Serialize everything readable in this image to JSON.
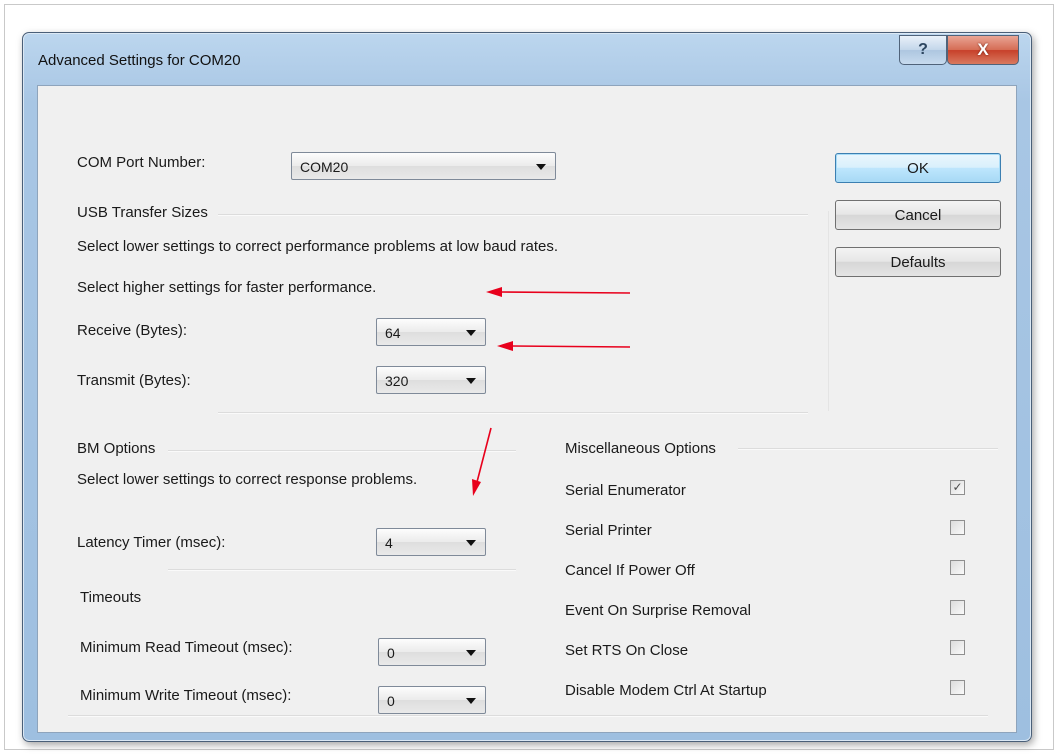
{
  "window": {
    "title": "Advanced Settings for COM20",
    "help_glyph": "?",
    "close_glyph": "X"
  },
  "com_port": {
    "label": "COM Port Number:",
    "value": "COM20"
  },
  "usb": {
    "heading": "USB Transfer Sizes",
    "desc1": "Select lower settings to correct performance problems at low baud rates.",
    "desc2": "Select higher settings for faster performance.",
    "receive_label": "Receive (Bytes):",
    "receive_value": "64",
    "transmit_label": "Transmit (Bytes):",
    "transmit_value": "320"
  },
  "bm": {
    "heading": "BM Options",
    "desc": "Select lower settings to correct response problems.",
    "latency_label": "Latency Timer (msec):",
    "latency_value": "4"
  },
  "timeouts": {
    "heading": "Timeouts",
    "read_label": "Minimum Read Timeout (msec):",
    "read_value": "0",
    "write_label": "Minimum Write Timeout (msec):",
    "write_value": "0"
  },
  "misc": {
    "heading": "Miscellaneous Options",
    "options": [
      {
        "label": "Serial Enumerator",
        "checked": true
      },
      {
        "label": "Serial Printer",
        "checked": false
      },
      {
        "label": "Cancel If Power Off",
        "checked": false
      },
      {
        "label": "Event On Surprise Removal",
        "checked": false
      },
      {
        "label": "Set RTS On Close",
        "checked": false
      },
      {
        "label": "Disable Modem Ctrl At Startup",
        "checked": false
      }
    ]
  },
  "buttons": {
    "ok": "OK",
    "cancel": "Cancel",
    "defaults": "Defaults"
  },
  "colors": {
    "annotation_arrow": "#e8001c",
    "window_frame": "#a8c6e4",
    "default_button": "#bee6fd"
  },
  "icons": {
    "dropdown": "chevron-down-icon",
    "check": "checkmark-icon"
  }
}
